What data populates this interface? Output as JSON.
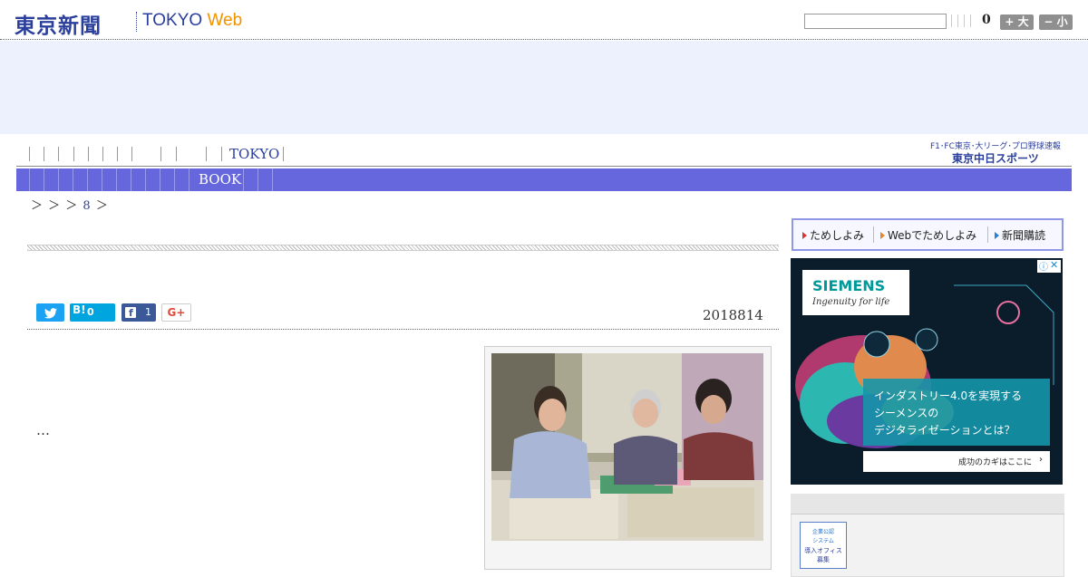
{
  "header": {
    "logo_jp": "東京新聞",
    "logo_en": "TOKYO",
    "logo_web": "Web",
    "search_placeholder": "",
    "counter": "0",
    "font_larger": "+ 大",
    "font_smaller": "− 小"
  },
  "nav": {
    "region_link": "TOKYO",
    "section_link": "BOOK",
    "promo_line1": "F1･FC東京･大リーグ･プロ野球速報",
    "promo_line2": "東京中日スポーツ"
  },
  "breadcrumb": {
    "text_before": "＞ ＞ ＞",
    "current": "8",
    "text_after": "＞"
  },
  "article": {
    "date": "2018814",
    "body_excerpt": "…",
    "share": {
      "hatena_label": "B!",
      "hatena_count": "0",
      "facebook_count": "1",
      "google_label": "G+"
    }
  },
  "sidebar": {
    "links": [
      {
        "label": "ためしよみ"
      },
      {
        "label": "Webでためしよみ"
      },
      {
        "label": "新聞購読"
      }
    ],
    "ad": {
      "brand": "SIEMENS",
      "tagline": "Ingenuity for life",
      "headline_1": "インダストリー4.0を実現する",
      "headline_2": "シーメンスの",
      "headline_3": "デジタライゼーションとは？",
      "cta": "成功のカギはここに"
    },
    "promo_box": {
      "line1": "企業公認",
      "line2": "システム",
      "line3": "導入オフィス",
      "line4": "募集"
    }
  },
  "colors": {
    "brand_blue": "#2a3e9c",
    "nav_bar": "#6666dd",
    "ad_band": "#edf1fd",
    "web_orange": "#f29300"
  }
}
